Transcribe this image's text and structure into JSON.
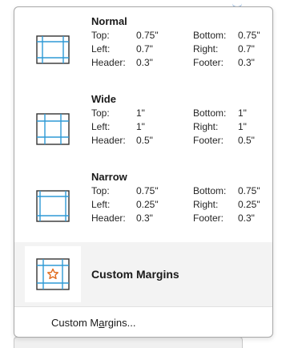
{
  "colors": {
    "page_border": "#333333",
    "margin_guide": "#2e9ad6",
    "star": "#e06a1b",
    "selected_bg": "#f3f3f3"
  },
  "margins_menu": {
    "presets": [
      {
        "name": "Normal",
        "icon": "margins-normal-icon",
        "top_label": "Top:",
        "top": "0.75\"",
        "bottom_label": "Bottom:",
        "bottom": "0.75\"",
        "left_label": "Left:",
        "left": "0.7\"",
        "right_label": "Right:",
        "right": "0.7\"",
        "header_label": "Header:",
        "header": "0.3\"",
        "footer_label": "Footer:",
        "footer": "0.3\""
      },
      {
        "name": "Wide",
        "icon": "margins-wide-icon",
        "top_label": "Top:",
        "top": "1\"",
        "bottom_label": "Bottom:",
        "bottom": "1\"",
        "left_label": "Left:",
        "left": "1\"",
        "right_label": "Right:",
        "right": "1\"",
        "header_label": "Header:",
        "header": "0.5\"",
        "footer_label": "Footer:",
        "footer": "0.5\""
      },
      {
        "name": "Narrow",
        "icon": "margins-narrow-icon",
        "top_label": "Top:",
        "top": "0.75\"",
        "bottom_label": "Bottom:",
        "bottom": "0.75\"",
        "left_label": "Left:",
        "left": "0.25\"",
        "right_label": "Right:",
        "right": "0.25\"",
        "header_label": "Header:",
        "header": "0.3\"",
        "footer_label": "Footer:",
        "footer": "0.3\""
      }
    ],
    "custom_preset": {
      "name": "Custom Margins",
      "icon": "custom-margins-star-icon"
    },
    "custom_command": {
      "label_before": "Custom M",
      "label_underlined": "a",
      "label_after": "rgins..."
    }
  }
}
